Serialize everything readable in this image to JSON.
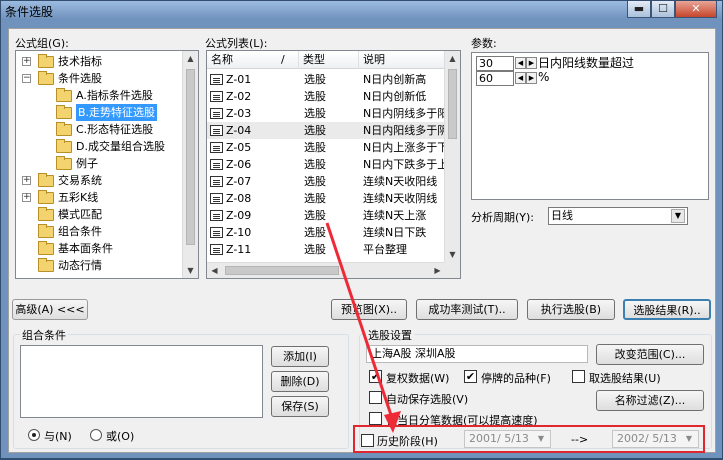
{
  "window": {
    "title": "条件选股",
    "min_glyph": "▬",
    "max_glyph": "☐",
    "close_glyph": "✕"
  },
  "formula_group": {
    "label": "公式组(G):",
    "tree": [
      {
        "label": "技术指标",
        "level": 1,
        "expander": "+"
      },
      {
        "label": "条件选股",
        "level": 1,
        "expander": "−"
      },
      {
        "label": "A.指标条件选股",
        "level": 2
      },
      {
        "label": "B.走势特征选股",
        "level": 2,
        "selected": true
      },
      {
        "label": "C.形态特征选股",
        "level": 2
      },
      {
        "label": "D.成交量组合选股",
        "level": 2
      },
      {
        "label": "例子",
        "level": 2
      },
      {
        "label": "交易系统",
        "level": 1,
        "expander": "+"
      },
      {
        "label": "五彩K线",
        "level": 1,
        "expander": "+"
      },
      {
        "label": "模式匹配",
        "level": 1
      },
      {
        "label": "组合条件",
        "level": 1
      },
      {
        "label": "基本面条件",
        "level": 1
      },
      {
        "label": "动态行情",
        "level": 1
      }
    ]
  },
  "formula_list": {
    "label": "公式列表(L):",
    "columns": [
      "名称",
      "/",
      "类型",
      "说明"
    ],
    "rows": [
      {
        "name": "Z-01",
        "type": "选股",
        "desc": "N日内创新高"
      },
      {
        "name": "Z-02",
        "type": "选股",
        "desc": "N日内创新低"
      },
      {
        "name": "Z-03",
        "type": "选股",
        "desc": "N日内阴线多于阳"
      },
      {
        "name": "Z-04",
        "type": "选股",
        "desc": "N日内阳线多于阴",
        "highlight": true
      },
      {
        "name": "Z-05",
        "type": "选股",
        "desc": "N日内上涨多于下"
      },
      {
        "name": "Z-06",
        "type": "选股",
        "desc": "N日内下跌多于上"
      },
      {
        "name": "Z-07",
        "type": "选股",
        "desc": "连续N天收阳线"
      },
      {
        "name": "Z-08",
        "type": "选股",
        "desc": "连续N天收阴线"
      },
      {
        "name": "Z-09",
        "type": "选股",
        "desc": "连续N天上涨"
      },
      {
        "name": "Z-10",
        "type": "选股",
        "desc": "连续N日下跌"
      },
      {
        "name": "Z-11",
        "type": "选股",
        "desc": "平台整理"
      }
    ]
  },
  "params": {
    "label": "参数:",
    "rows": [
      {
        "value": "30",
        "suffix": "日内阳线数量超过"
      },
      {
        "value": "60",
        "suffix": "%"
      }
    ],
    "period_label": "分析周期(Y):",
    "period_value": "日线"
  },
  "buttons": {
    "advanced": "高级(A) <<<",
    "preview": "预览图(X)..",
    "success_rate": "成功率测试(T)..",
    "execute": "执行选股(B)",
    "result": "选股结果(R)..",
    "add": "添加(I)",
    "delete": "删除(D)",
    "save": "保存(S)",
    "change_range": "改变范围(C)...",
    "name_filter": "名称过滤(Z)..."
  },
  "combo_conditions": {
    "title": "组合条件",
    "and_label": "与(N)",
    "or_label": "或(O)"
  },
  "stock_settings": {
    "title": "选股设置",
    "range_text": "上海A股   深圳A股",
    "rights_label": "复权数据(W)",
    "suspended_label": "停牌的品种(F)",
    "cancel_result_label": "取选股结果(U)",
    "auto_save_label": "自动保存选股(V)",
    "only_day_label": "仅当日分笔数据(可以提高速度)",
    "history_label": "历史阶段(H)",
    "date_from": "2001/ 5/13",
    "arrow": "-->",
    "date_to": "2002/ 5/13"
  },
  "colors": {
    "highlight_box": "#e0262f",
    "arrow": "#ee2a36",
    "selection": "#3399ff"
  }
}
